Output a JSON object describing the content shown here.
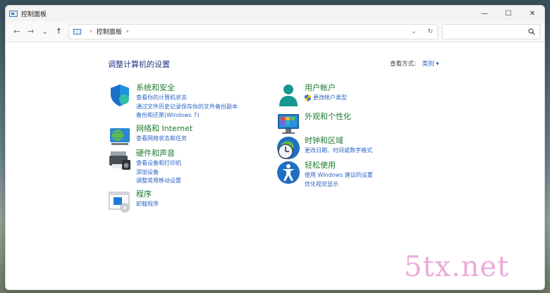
{
  "window": {
    "title": "控制面板",
    "controls": {
      "minimize": "—",
      "maximize": "☐",
      "close": "✕"
    }
  },
  "nav": {
    "back": "←",
    "forward": "→",
    "recent": "⌄",
    "up": "↑",
    "breadcrumb": [
      "控制面板"
    ],
    "separator": "›",
    "dropdown": "⌄",
    "refresh": "↻",
    "search_placeholder": ""
  },
  "main": {
    "title": "调整计算机的设置",
    "view_by_label": "查看方式:",
    "view_by_value": "类别 ▾"
  },
  "categories_left": [
    {
      "name": "系统和安全",
      "links": [
        "查看你的计算机状态",
        "通过文件历史记录保存你的文件备份副本",
        "备份和还原(Windows 7)"
      ]
    },
    {
      "name": "网络和 Internet",
      "links": [
        "查看网络状态和任务"
      ]
    },
    {
      "name": "硬件和声音",
      "links": [
        "查看设备和打印机",
        "添加设备",
        "调整常用移动设置"
      ]
    },
    {
      "name": "程序",
      "links": [
        "卸载程序"
      ]
    }
  ],
  "categories_right": [
    {
      "name": "用户帐户",
      "links": [
        "更改帐户类型"
      ]
    },
    {
      "name": "外观和个性化",
      "links": []
    },
    {
      "name": "时钟和区域",
      "links": [
        "更改日期、时间或数字格式"
      ]
    },
    {
      "name": "轻松使用",
      "links": [
        "使用 Windows 建议的设置",
        "优化视觉显示"
      ]
    }
  ],
  "watermark": "5tx.net",
  "colors": {
    "heading_green": "#1c7a2e",
    "link_blue": "#2b64c6",
    "title_navy": "#1e3287"
  }
}
